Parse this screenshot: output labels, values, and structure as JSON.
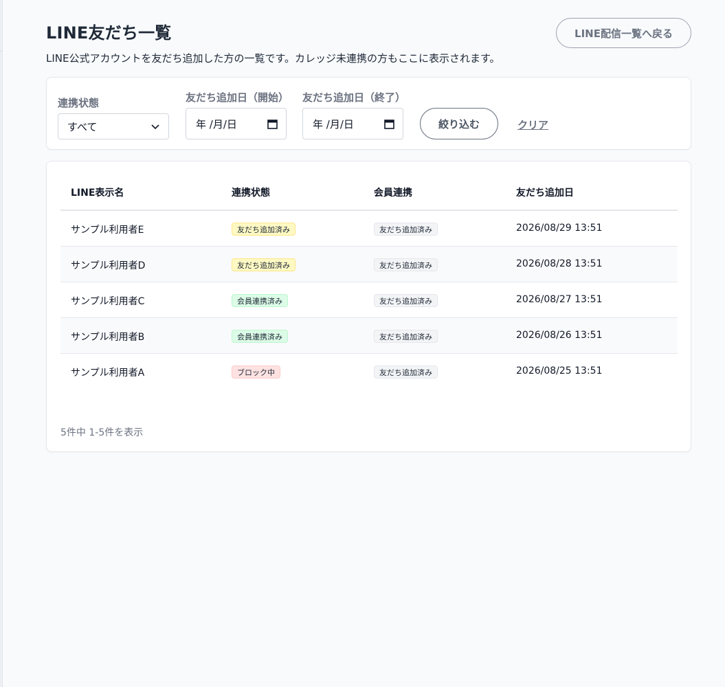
{
  "header": {
    "title": "LINE友だち一覧",
    "description": "LINE公式アカウントを友だち追加した方の一覧です。カレッジ未連携の方もここに表示されます。",
    "back_button_label": "LINE配信一覧へ戻る"
  },
  "filters": {
    "status_label": "連携状態",
    "status_value": "すべて",
    "date_start_label": "友だち追加日（開始）",
    "date_start_value": "年 /月/日",
    "date_end_label": "友だち追加日（終了）",
    "date_end_value": "年 /月/日",
    "filter_button_label": "絞り込む",
    "clear_label": "クリア"
  },
  "table": {
    "columns": [
      "LINE表示名",
      "連携状態",
      "会員連携",
      "友だち追加日"
    ],
    "rows": [
      {
        "name": "サンプル利用者E",
        "status": "友だち追加済み",
        "status_color": "yellow",
        "member": "友だち追加済み",
        "date": "2026/08/29 13:51"
      },
      {
        "name": "サンプル利用者D",
        "status": "友だち追加済み",
        "status_color": "yellow",
        "member": "友だち追加済み",
        "date": "2026/08/28 13:51"
      },
      {
        "name": "サンプル利用者C",
        "status": "会員連携済み",
        "status_color": "green",
        "member": "友だち追加済み",
        "date": "2026/08/27 13:51"
      },
      {
        "name": "サンプル利用者B",
        "status": "会員連携済み",
        "status_color": "green",
        "member": "友だち追加済み",
        "date": "2026/08/26 13:51"
      },
      {
        "name": "サンプル利用者A",
        "status": "ブロック中",
        "status_color": "red",
        "member": "友だち追加済み",
        "date": "2026/08/25 13:51"
      }
    ]
  },
  "pagination": {
    "info": "5件中 1-5件を表示"
  },
  "icons": {
    "select": "chevron-down-icon",
    "date": "calendar-icon"
  },
  "colors": {
    "background": "#f8fafc",
    "badge_yellow": "#fef9c3",
    "badge_green": "#dcfce7",
    "badge_red": "#fee2e2",
    "badge_gray": "#f3f4f6"
  }
}
